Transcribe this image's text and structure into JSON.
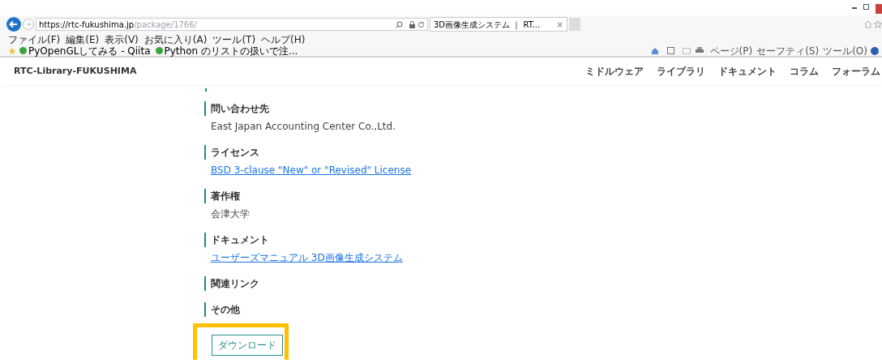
{
  "browser": {
    "url_host": "https://rtc-fukushima.jp",
    "url_path": "/package/1766/",
    "tab_title": "3D画像生成システム ｜ RT...",
    "tab_close": "×",
    "menu": [
      "ファイル(F)",
      "編集(E)",
      "表示(V)",
      "お気に入り(A)",
      "ツール(T)",
      "ヘルプ(H)"
    ],
    "favorites": [
      "PyOpenGLしてみる - Qiita",
      "Python のリストの扱いで注..."
    ],
    "command_bar": [
      "ページ(P)",
      "セーフティ(S)",
      "ツール(O)"
    ]
  },
  "site": {
    "title": "RTC-Library-FUKUSHIMA",
    "nav": [
      "ミドルウェア",
      "ライブラリ",
      "ドキュメント",
      "コラム",
      "フォーラム"
    ]
  },
  "sections": [
    {
      "heading": "問い合わせ先",
      "kind": "text",
      "value": "East Japan Accounting Center Co.,Ltd."
    },
    {
      "heading": "ライセンス",
      "kind": "link",
      "value": "BSD 3-clause \"New\" or \"Revised\" License"
    },
    {
      "heading": "著作権",
      "kind": "text",
      "value": "会津大学"
    },
    {
      "heading": "ドキュメント",
      "kind": "link",
      "value": "ユーザーズマニュアル  3D画像生成システム"
    },
    {
      "heading": "関連リンク",
      "kind": "empty"
    },
    {
      "heading": "その他",
      "kind": "empty"
    }
  ],
  "download_button": {
    "label": "ダウンロード",
    "highlighted": true
  }
}
